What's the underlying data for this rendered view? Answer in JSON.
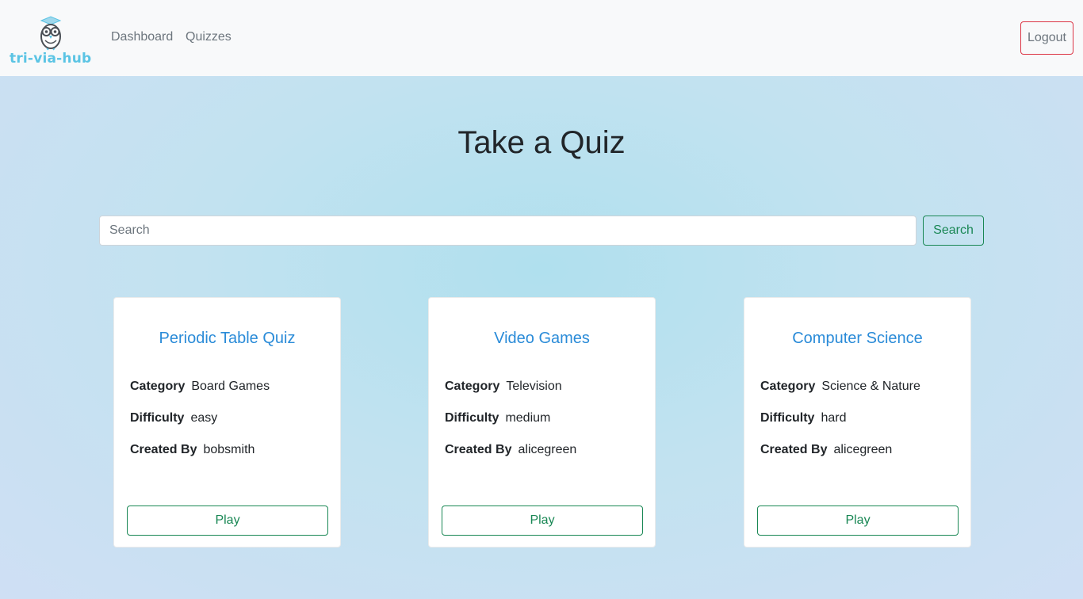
{
  "nav": {
    "logo_text": "tri-via-hub",
    "links": [
      {
        "label": "Dashboard"
      },
      {
        "label": "Quizzes"
      }
    ],
    "logout_label": "Logout"
  },
  "page": {
    "title": "Take a Quiz"
  },
  "search": {
    "placeholder": "Search",
    "button_label": "Search"
  },
  "labels": {
    "category": "Category",
    "difficulty": "Difficulty",
    "created_by": "Created By"
  },
  "quizzes": [
    {
      "title": "Periodic Table Quiz",
      "category": "Board Games",
      "difficulty": "easy",
      "created_by": "bobsmith",
      "play_label": "Play"
    },
    {
      "title": "Video Games",
      "category": "Television",
      "difficulty": "medium",
      "created_by": "alicegreen",
      "play_label": "Play"
    },
    {
      "title": "Computer Science",
      "category": "Science & Nature",
      "difficulty": "hard",
      "created_by": "alicegreen",
      "play_label": "Play"
    }
  ],
  "colors": {
    "brand": "#5bc4e4",
    "success": "#198754",
    "danger": "#dc3545",
    "link_title": "#2a8bd8"
  },
  "icons": {
    "logo": "owl-logo-icon"
  }
}
